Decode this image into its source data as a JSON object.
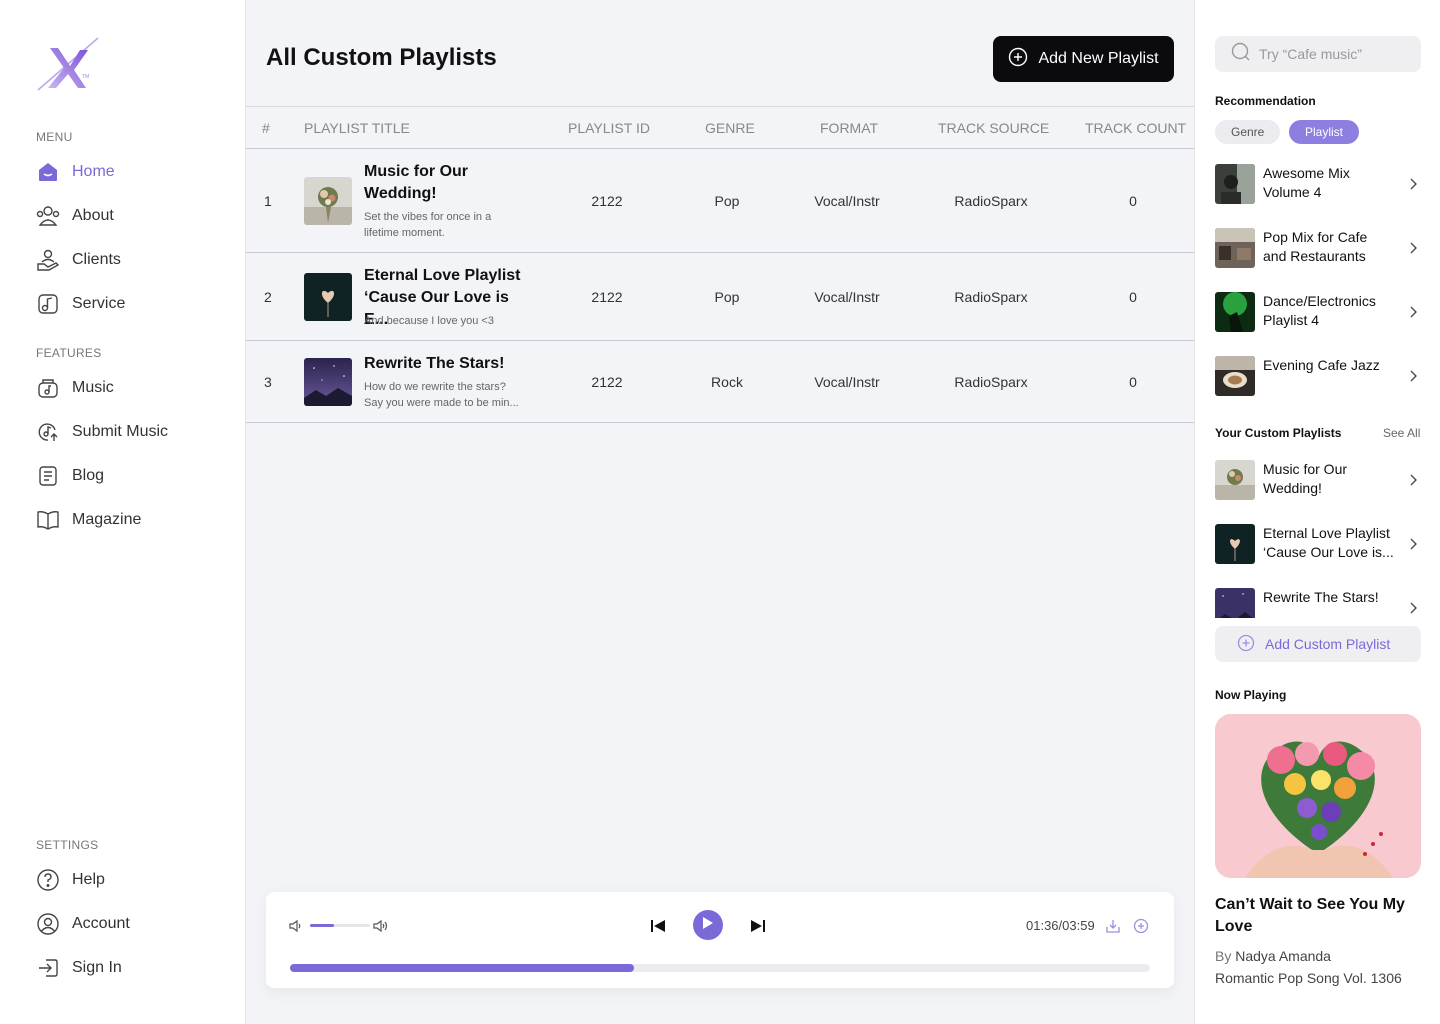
{
  "brand": {
    "logo_mark": "X",
    "trademark": "TM"
  },
  "sidebar": {
    "menu_label": "MENU",
    "menu_items": [
      {
        "label": "Home",
        "icon": "home-icon",
        "active": true
      },
      {
        "label": "About",
        "icon": "users-icon"
      },
      {
        "label": "Clients",
        "icon": "clients-icon"
      },
      {
        "label": "Service",
        "icon": "service-icon"
      }
    ],
    "features_label": "FEATURES",
    "feature_items": [
      {
        "label": "Music",
        "icon": "music-icon"
      },
      {
        "label": "Submit Music",
        "icon": "submit-music-icon"
      },
      {
        "label": "Blog",
        "icon": "blog-icon"
      },
      {
        "label": "Magazine",
        "icon": "book-icon"
      }
    ],
    "settings_label": "SETTINGS",
    "settings_items": [
      {
        "label": "Help",
        "icon": "help-icon"
      },
      {
        "label": "Account",
        "icon": "account-icon"
      },
      {
        "label": "Sign In",
        "icon": "sign-in-icon"
      }
    ]
  },
  "main": {
    "title": "All Custom Playlists",
    "add_button_label": "Add New Playlist",
    "columns": [
      "#",
      "PLAYLIST TITLE",
      "PLAYLIST ID",
      "GENRE",
      "FORMAT",
      "TRACK SOURCE",
      "TRACK COUNT"
    ],
    "rows": [
      {
        "num": "1",
        "title_line1": "Music for Our",
        "title_line2": "Wedding!",
        "desc_line1": "Set the vibes for once in a",
        "desc_line2": "lifetime moment.",
        "id": "2122",
        "genre": "Pop",
        "format": "Vocal/Instr",
        "source": "RadioSparx",
        "count": "0"
      },
      {
        "num": "2",
        "title_line1": "Eternal Love Playlist",
        "title_line2": "‘Cause Our Love is E...",
        "desc_line1": "And because I love you <3",
        "desc_line2": "",
        "id": "2122",
        "genre": "Pop",
        "format": "Vocal/Instr",
        "source": "RadioSparx",
        "count": "0"
      },
      {
        "num": "3",
        "title_line1": "Rewrite The Stars!",
        "title_line2": "",
        "desc_line1": "How do we rewrite the stars?",
        "desc_line2": "Say you were made to be min...",
        "id": "2122",
        "genre": "Rock",
        "format": "Vocal/Instr",
        "source": "RadioSparx",
        "count": "0"
      }
    ]
  },
  "player": {
    "time": "01:36/03:59",
    "progress": 0.4,
    "volume": 0.4,
    "accent": "#7a6ad8"
  },
  "right": {
    "search_placeholder": "Try “Cafe music”",
    "recommendation_label": "Recommendation",
    "chips": [
      "Genre",
      "Playlist"
    ],
    "active_chip": "Playlist",
    "recommendations": [
      {
        "line1": "Awesome Mix",
        "line2": "Volume 4"
      },
      {
        "line1": "Pop Mix for Cafe",
        "line2": "and Restaurants"
      },
      {
        "line1": "Dance/Electronics",
        "line2": "Playlist 4"
      },
      {
        "line1": "Evening Cafe Jazz",
        "line2": ""
      }
    ],
    "custom_label": "Your Custom Playlists",
    "see_all": "See All",
    "custom_playlists": [
      {
        "line1": "Music for Our",
        "line2": "Wedding!"
      },
      {
        "line1": "Eternal Love Playlist",
        "line2": "‘Cause Our Love is..."
      },
      {
        "line1": "Rewrite The Stars!",
        "line2": ""
      }
    ],
    "add_custom_label": "Add Custom Playlist",
    "now_playing_label": "Now Playing",
    "now_playing": {
      "title": "Can’t Wait to See You My Love",
      "by": "By",
      "artist": "Nadya Amanda",
      "album": "Romantic Pop Song Vol. 1306"
    }
  }
}
